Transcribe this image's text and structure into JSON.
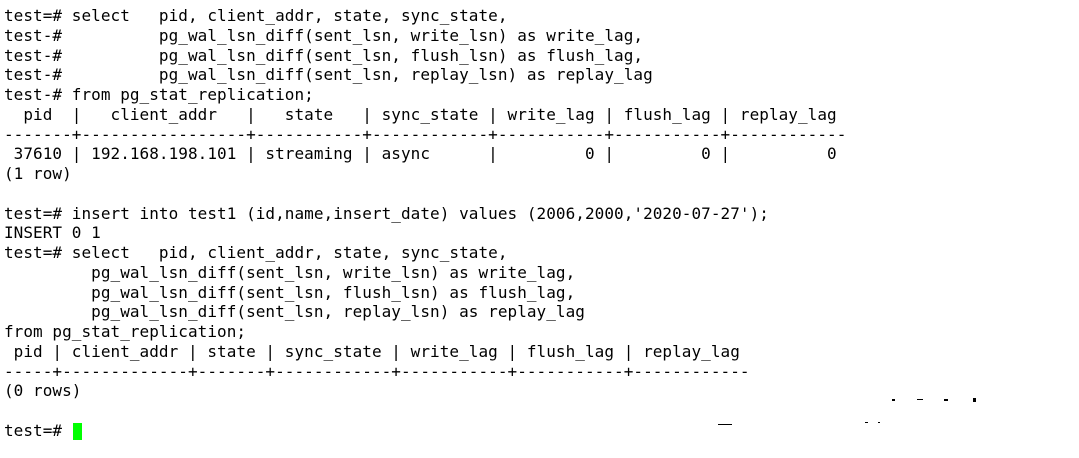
{
  "terminal": {
    "lines": [
      "test=# select   pid, client_addr, state, sync_state,",
      "test-#          pg_wal_lsn_diff(sent_lsn, write_lsn) as write_lag,",
      "test-#          pg_wal_lsn_diff(sent_lsn, flush_lsn) as flush_lag,",
      "test-#          pg_wal_lsn_diff(sent_lsn, replay_lsn) as replay_lag",
      "test-# from pg_stat_replication;",
      "  pid  |   client_addr   |   state   | sync_state | write_lag | flush_lag | replay_lag",
      "-------+-----------------+-----------+------------+-----------+-----------+------------",
      " 37610 | 192.168.198.101 | streaming | async      |         0 |         0 |          0",
      "(1 row)",
      "",
      "test=# insert into test1 (id,name,insert_date) values (2006,2000,'2020-07-27');",
      "INSERT 0 1",
      "test=# select   pid, client_addr, state, sync_state,",
      "         pg_wal_lsn_diff(sent_lsn, write_lsn) as write_lag,",
      "         pg_wal_lsn_diff(sent_lsn, flush_lsn) as flush_lag,",
      "         pg_wal_lsn_diff(sent_lsn, replay_lsn) as replay_lag",
      "from pg_stat_replication;",
      " pid | client_addr | state | sync_state | write_lag | flush_lag | replay_lag",
      "-----+-------------+-------+------------+-----------+-----------+------------",
      "(0 rows)",
      ""
    ],
    "prompt": "test=# ",
    "cursor_color": "#00ff00",
    "text_color": "#000000",
    "background_color": "#ffffff"
  }
}
